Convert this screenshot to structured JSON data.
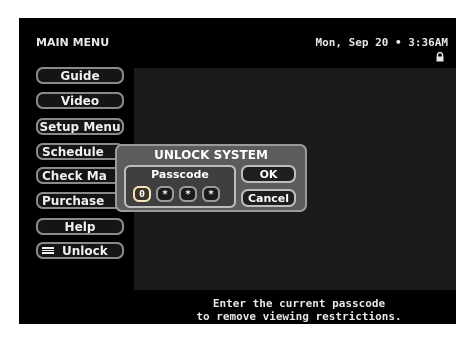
{
  "header": {
    "title": "MAIN MENU",
    "datetime": "Mon, Sep 20 • 3:36AM",
    "lock_icon": "lock-icon"
  },
  "menu": {
    "items": [
      {
        "label": "Guide"
      },
      {
        "label": "Video"
      },
      {
        "label": "Setup Menu"
      },
      {
        "label": "Schedule"
      },
      {
        "label": "Check Ma"
      },
      {
        "label": "Purchase"
      },
      {
        "label": "Help"
      },
      {
        "label": "Unlock",
        "icon": "unlock-icon"
      }
    ]
  },
  "dialog": {
    "title": "UNLOCK SYSTEM",
    "passcode_label": "Passcode",
    "digits": [
      "0",
      "*",
      "*",
      "*"
    ],
    "ok_label": "OK",
    "cancel_label": "Cancel"
  },
  "footer": {
    "line1": "Enter the current passcode",
    "line2": "to remove viewing restrictions."
  },
  "colors": {
    "background": "#000000",
    "button_border": "#8a8a8a",
    "dialog_bg": "#5c5c5c",
    "active_digit_border": "#f4e3b8"
  }
}
